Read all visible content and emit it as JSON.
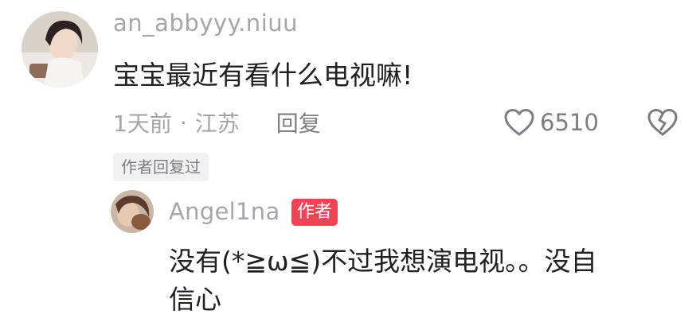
{
  "comment": {
    "username": "an_abbyyy.niuu",
    "text": "宝宝最近有看什么电视嘛!",
    "time": "1天前",
    "separator": "·",
    "location": "江苏",
    "reply_label": "回复",
    "like_count": "6510",
    "author_replied_tag": "作者回复过"
  },
  "reply": {
    "username": "Angel1na",
    "badge": "作者",
    "text_line1": "没有(*≧ω≦)不过我想演电视。。没自",
    "text_line2": "信心"
  },
  "colors": {
    "secondary_text": "#a5a6ab",
    "badge_bg": "#f04455",
    "tag_bg": "#f1f1f2"
  },
  "icons": {
    "like": "heart-outline-icon",
    "dislike": "broken-heart-icon"
  }
}
